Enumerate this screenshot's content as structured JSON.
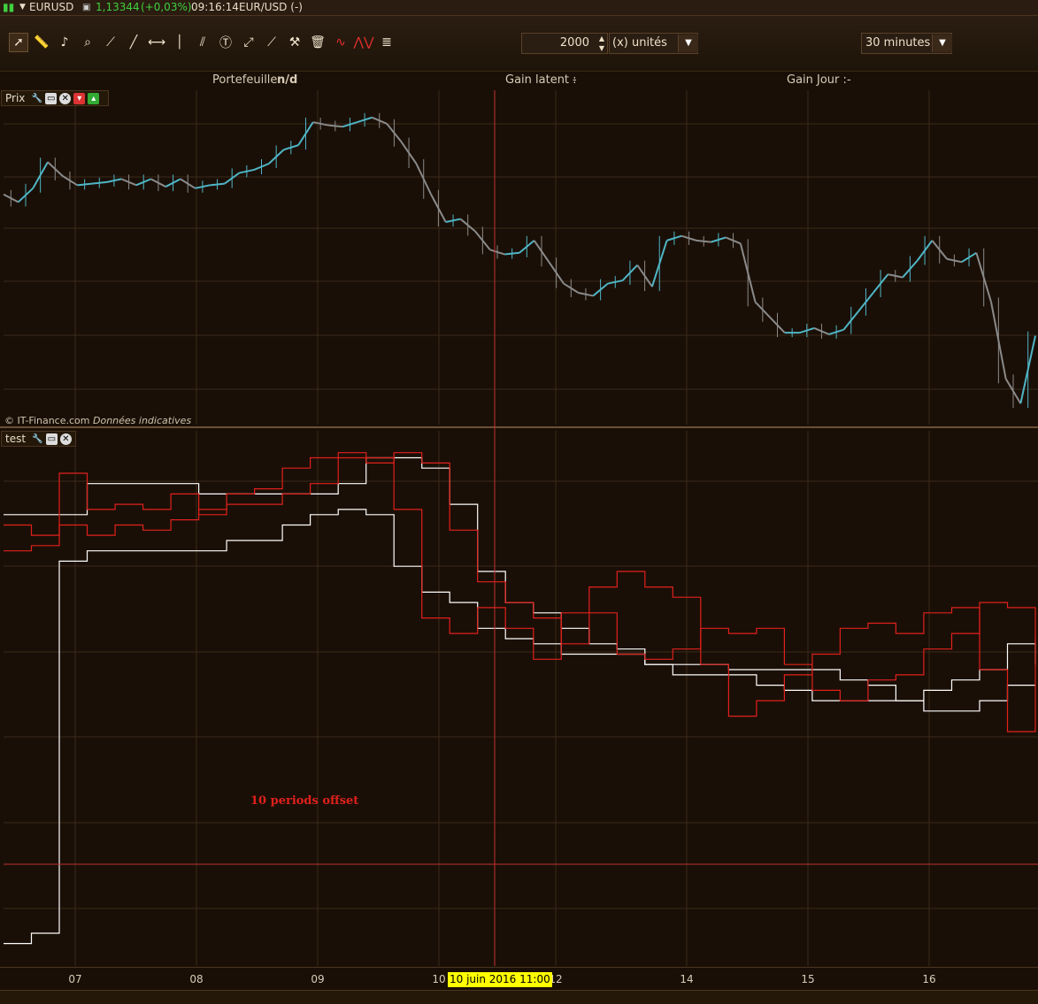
{
  "topbar": {
    "symbol": "EURUSD",
    "price": "1,13344",
    "change": "(+0,03%)",
    "time": "09:16:14",
    "pair_label": "EUR/USD (-)"
  },
  "toolbar": {
    "tools": [
      "cursor-icon",
      "ruler-icon",
      "alarm-bell-icon",
      "zoom-icon",
      "segment-icon",
      "line-icon",
      "horizontal-line-icon",
      "vertical-line-icon",
      "channel-icon",
      "text-icon",
      "arrows-icon",
      "fan-icon",
      "tools-icon",
      "trash-icon",
      "wave-icon",
      "zigzag-icon",
      "fibonacci-icon"
    ],
    "quantity": "2000",
    "quantity_unit": "(x) unités",
    "timeframe": "30 minutes"
  },
  "infobar": {
    "portfolio_label": "Portefeuille:",
    "portfolio_value": "n/d",
    "latent_label": "Gain latent :",
    "latent_value": "-",
    "day_label": "Gain Jour :",
    "day_value": "-"
  },
  "price_panel": {
    "title": "Prix",
    "credit_source": "© IT-Finance.com",
    "credit_note": "Données indicatives"
  },
  "indicator_panel": {
    "title": "test",
    "annotation": "10 periods offset"
  },
  "cursor_label": "10 juin 2016 11:00",
  "colors": {
    "price_up": "#4fb6c6",
    "price_down": "#8a8a8a",
    "white_line": "#ffffff",
    "red_line": "#e0201c",
    "grid": "#3a2a1a",
    "crosshair": "#c03030"
  },
  "chart_data": [
    {
      "type": "line",
      "title": "Prix",
      "x_tick_labels": [
        "07",
        "08",
        "09",
        "10",
        "12",
        "14",
        "15",
        "16"
      ],
      "series": [
        {
          "values": [
            0.0,
            -0.25,
            0.2,
            1.05,
            0.6,
            0.3,
            0.35,
            0.4,
            0.5,
            0.3,
            0.5,
            0.25,
            0.5,
            0.2,
            0.3,
            0.35,
            0.7,
            0.8,
            1.0,
            1.45,
            1.6,
            2.35,
            2.25,
            2.2,
            2.35,
            2.5,
            2.3,
            1.7,
            1.0,
            0.0,
            -0.9,
            -0.8,
            -1.2,
            -1.8,
            -1.95,
            -1.9,
            -1.5,
            -2.2,
            -2.9,
            -3.2,
            -3.3,
            -2.9,
            -2.8,
            -2.3,
            -3.0,
            -1.5,
            -1.35,
            -1.5,
            -1.55,
            -1.4,
            -1.6,
            -3.5,
            -4.0,
            -4.5,
            -4.5,
            -4.35,
            -4.55,
            -4.4,
            -3.8,
            -3.2,
            -2.6,
            -2.7,
            -2.15,
            -1.5,
            -2.1,
            -2.2,
            -1.9,
            -3.5,
            -6.0,
            -6.8,
            -4.6
          ]
        }
      ]
    },
    {
      "type": "line",
      "title": "test",
      "x_tick_labels": [
        "07",
        "08",
        "09",
        "10",
        "12",
        "14",
        "15",
        "16"
      ],
      "series": [
        {
          "color": "#ffffff",
          "values": [
            4.5,
            4.5,
            4.5,
            5.1,
            5.1,
            5.1,
            5.1,
            4.9,
            4.9,
            4.9,
            4.9,
            4.9,
            5.1,
            5.6,
            5.6,
            5.4,
            4.7,
            3.4,
            2.8,
            2.6,
            2.3,
            2.0,
            1.9,
            1.6,
            1.6,
            1.6,
            1.5,
            1.5,
            1.5,
            1.5,
            1.3,
            1.2,
            0.9,
            0.7,
            0.7,
            0.9,
            1.2,
            1.2
          ]
        },
        {
          "color": "#ffffff",
          "values": [
            -3.8,
            -3.6,
            3.6,
            3.8,
            3.8,
            3.8,
            3.8,
            3.8,
            4.0,
            4.0,
            4.3,
            4.5,
            4.6,
            4.5,
            3.5,
            3.0,
            2.8,
            2.3,
            2.1,
            2.0,
            1.8,
            1.8,
            1.8,
            1.6,
            1.4,
            1.4,
            1.4,
            1.2,
            1.1,
            0.9,
            0.9,
            0.9,
            0.9,
            1.1,
            1.3,
            1.5,
            2.0,
            1.6
          ]
        },
        {
          "color": "#e0201c",
          "values": [
            4.3,
            4.1,
            5.3,
            4.6,
            4.7,
            4.6,
            4.9,
            4.5,
            4.7,
            4.7,
            4.9,
            5.1,
            5.6,
            5.5,
            5.7,
            5.5,
            4.2,
            3.2,
            2.8,
            2.5,
            2.0,
            2.6,
            1.8,
            1.7,
            1.9,
            2.3,
            2.2,
            2.3,
            1.6,
            1.1,
            0.9,
            1.3,
            1.4,
            1.9,
            2.2,
            2.8,
            2.7,
            2.0
          ]
        },
        {
          "color": "#e0201c",
          "values": [
            3.8,
            3.9,
            4.3,
            4.1,
            4.3,
            4.2,
            4.4,
            4.6,
            4.9,
            5.0,
            5.4,
            5.6,
            5.7,
            5.6,
            4.6,
            2.5,
            2.2,
            2.7,
            2.3,
            1.7,
            2.6,
            3.1,
            3.4,
            3.1,
            2.9,
            1.6,
            0.6,
            0.9,
            1.4,
            1.8,
            2.3,
            2.4,
            2.2,
            2.6,
            2.7,
            1.5,
            0.3,
            2.1
          ]
        }
      ]
    }
  ]
}
